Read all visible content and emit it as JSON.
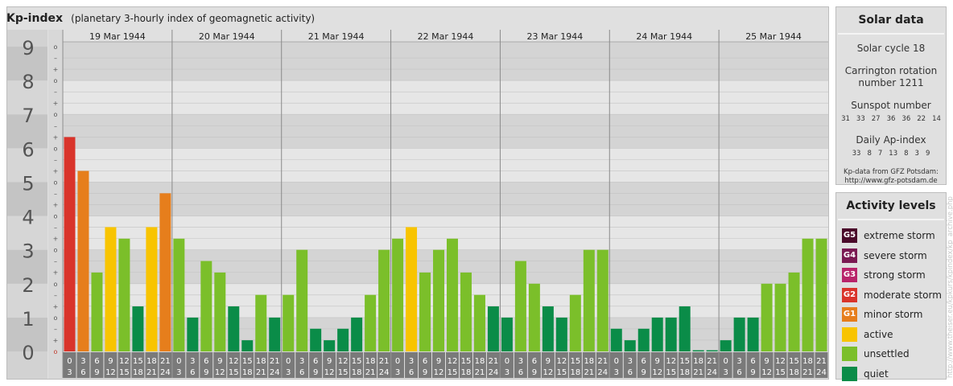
{
  "header": {
    "title": "Kp-index",
    "subtitle": "(planetary 3-hourly index of geomagnetic activity)"
  },
  "colors": {
    "quiet": "#0a8c48",
    "unsettled": "#7bbf2a",
    "active": "#f8c400",
    "minor_storm": "#e67e1c",
    "moderate_storm": "#d9342b",
    "strong_storm": "#b8246a",
    "severe_storm": "#7a1a52",
    "extreme_storm": "#4a0a2a"
  },
  "chart_data": {
    "type": "bar",
    "ylim": [
      0,
      9
    ],
    "y_major_labels": [
      "0",
      "1",
      "2",
      "3",
      "4",
      "5",
      "6",
      "7",
      "8",
      "9"
    ],
    "y_minor_labels": [
      "o",
      "+",
      "–"
    ],
    "days": [
      "19 Mar 1944",
      "20 Mar 1944",
      "21 Mar 1944",
      "22 Mar 1944",
      "23 Mar 1944",
      "24 Mar 1944",
      "25 Mar 1944"
    ],
    "x_tick_labels": [
      [
        "0",
        "3"
      ],
      [
        "3",
        "6"
      ],
      [
        "6",
        "9"
      ],
      [
        "9",
        "12"
      ],
      [
        "12",
        "15"
      ],
      [
        "15",
        "18"
      ],
      [
        "18",
        "21"
      ],
      [
        "21",
        "24"
      ]
    ],
    "series": [
      {
        "values": [
          6.33,
          5.33,
          2.33,
          3.67,
          3.33,
          1.33,
          3.67,
          4.67,
          3.33,
          1.0,
          2.67,
          2.33,
          1.33,
          0.33,
          1.67,
          1.0,
          1.67,
          3.0,
          0.67,
          0.33,
          0.67,
          1.0,
          1.67,
          3.0,
          3.33,
          3.67,
          2.33,
          3.0,
          3.33,
          2.33,
          1.67,
          1.33,
          1.0,
          2.67,
          2.0,
          1.33,
          1.0,
          1.67,
          3.0,
          3.0,
          0.67,
          0.33,
          0.67,
          1.0,
          1.0,
          1.33,
          0.0,
          0.0,
          0.33,
          1.0,
          1.0,
          2.0,
          2.0,
          2.33,
          3.33,
          3.33
        ]
      }
    ]
  },
  "solar": {
    "heading": "Solar data",
    "cycle": "Solar cycle 18",
    "carrington_line1": "Carrington rotation",
    "carrington_line2": "number 1211",
    "sunspot_label": "Sunspot number",
    "sunspot_values": [
      "31",
      "33",
      "27",
      "36",
      "36",
      "22",
      "14"
    ],
    "ap_label": "Daily Ap-index",
    "ap_values": [
      "33",
      "8",
      "7",
      "13",
      "8",
      "3",
      "9"
    ],
    "credit_line1": "Kp-data from GFZ Potsdam:",
    "credit_line2": "http://www.gfz-potsdam.de"
  },
  "levels": {
    "heading": "Activity levels",
    "items": [
      {
        "badge": "G5",
        "label": "extreme storm",
        "color": "#4a0a2a"
      },
      {
        "badge": "G4",
        "label": "severe storm",
        "color": "#7a1a52"
      },
      {
        "badge": "G3",
        "label": "strong storm",
        "color": "#b8246a"
      },
      {
        "badge": "G2",
        "label": "moderate storm",
        "color": "#d9342b"
      },
      {
        "badge": "G1",
        "label": "minor storm",
        "color": "#e67e1c"
      },
      {
        "badge": "",
        "label": "active",
        "color": "#f8c400"
      },
      {
        "badge": "",
        "label": "unsettled",
        "color": "#7bbf2a"
      },
      {
        "badge": "",
        "label": "quiet",
        "color": "#0a8c48"
      }
    ]
  },
  "watermark": "http://www.theiser.eu/kpkurs/kpindex/kp_archive.php"
}
